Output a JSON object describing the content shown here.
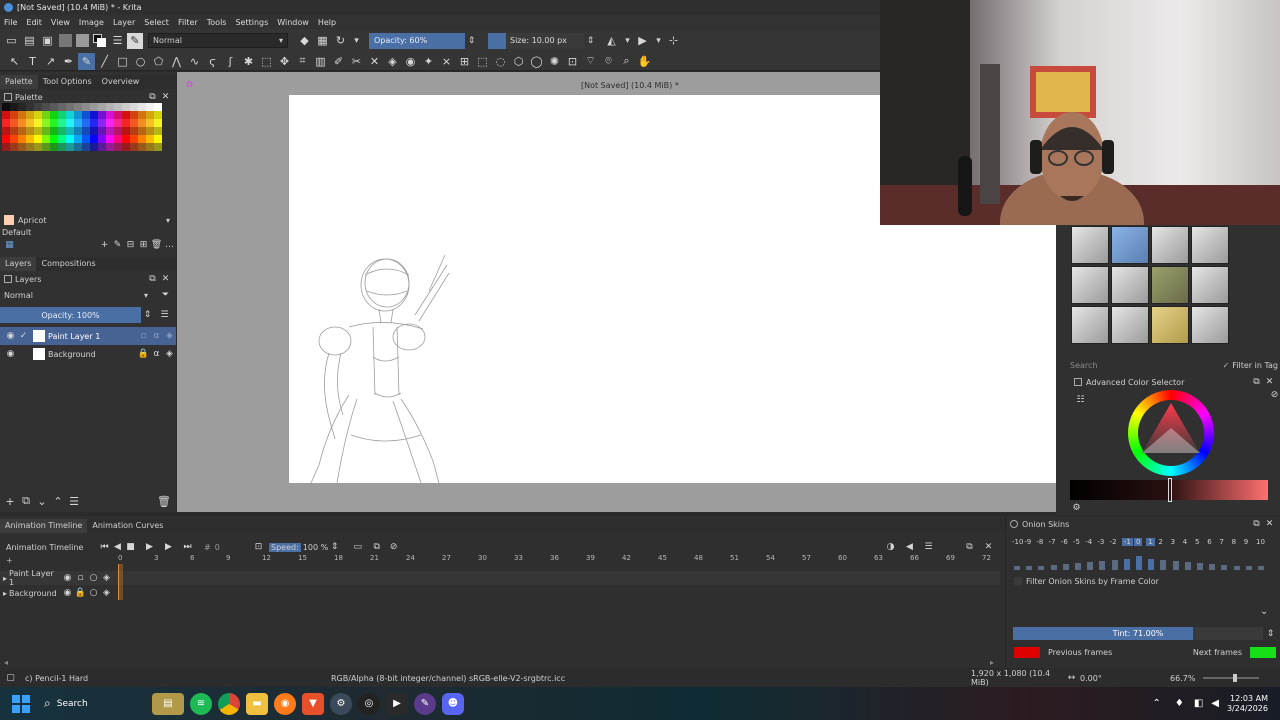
{
  "window": {
    "title": "[Not Saved] (10.4 MiB) * - Krita"
  },
  "menu": [
    "File",
    "Edit",
    "View",
    "Image",
    "Layer",
    "Select",
    "Filter",
    "Tools",
    "Settings",
    "Window",
    "Help"
  ],
  "toolbar": {
    "blend_mode": "Normal",
    "opacity": "Opacity: 60%",
    "size": "Size: 10.00 px"
  },
  "left_dock": {
    "tabs": [
      "Palette",
      "Tool Options",
      "Overview"
    ],
    "palette_title": "Palette",
    "color_name": "Apricot",
    "palette_set": "Default",
    "layers_tabs": [
      "Layers",
      "Compositions"
    ],
    "layers_title": "Layers",
    "layer_blend": "Normal",
    "layer_opacity": "Opacity:  100%",
    "layers": [
      {
        "name": "Paint Layer 1",
        "selected": true
      },
      {
        "name": "Background",
        "selected": false
      }
    ]
  },
  "canvas": {
    "tab_title": "[Not Saved]  (10.4 MiB) *"
  },
  "right_dock": {
    "search_placeholder": "Search",
    "filter_in_tag": "Filter in Tag",
    "color_selector_title": "Advanced Color Selector"
  },
  "timeline": {
    "tabs": [
      "Animation Timeline",
      "Animation Curves"
    ],
    "title": "Animation Timeline",
    "frame": "0",
    "speed_label": "Speed:",
    "speed_value": "100 %",
    "frame_numbers": [
      "0",
      "3",
      "6",
      "9",
      "12",
      "15",
      "18",
      "21",
      "24",
      "27",
      "30",
      "33",
      "36",
      "39",
      "42",
      "45",
      "48",
      "51",
      "54",
      "57",
      "60",
      "63",
      "66",
      "69",
      "72"
    ],
    "layers": [
      "Paint Layer 1",
      "Background"
    ]
  },
  "onion": {
    "title": "Onion Skins",
    "numbers": [
      "-10",
      "-9",
      "-8",
      "-7",
      "-6",
      "-5",
      "-4",
      "-3",
      "-2",
      "-1",
      "0",
      "1",
      "2",
      "3",
      "4",
      "5",
      "6",
      "7",
      "8",
      "9",
      "10"
    ],
    "filter_label": "Filter Onion Skins by Frame Color",
    "tint": "Tint: 71.00%",
    "tint_fraction": 0.71,
    "previous_frames": "Previous frames",
    "next_frames": "Next frames",
    "previous_color": "#e00000",
    "next_color": "#18e018"
  },
  "status": {
    "brush": "c) Pencil-1 Hard",
    "color_profile": "RGB/Alpha (8-bit integer/channel)  sRGB-elle-V2-srgbtrc.icc",
    "image_size": "1,920 x 1,080 (10.4 MiB)",
    "rotation": "0.00°",
    "zoom": "66.7%"
  },
  "taskbar": {
    "search": "Search",
    "time": "12:03 AM",
    "date": "3/24/2026"
  }
}
